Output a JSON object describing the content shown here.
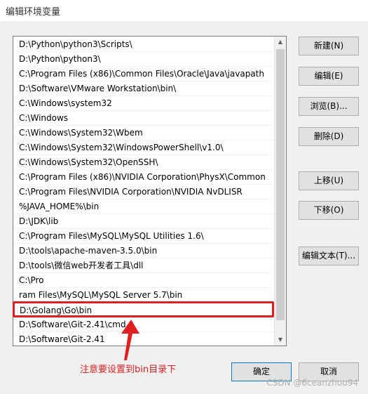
{
  "window": {
    "title": "编辑环境变量"
  },
  "paths": [
    "D:\\Python\\python3\\Scripts\\",
    "D:\\Python\\python3\\",
    "C:\\Program Files (x86)\\Common Files\\Oracle\\Java\\javapath",
    "D:\\Software\\VMware Workstation\\bin\\",
    "C:\\Windows\\system32",
    "C:\\Windows",
    "C:\\Windows\\System32\\Wbem",
    "C:\\Windows\\System32\\WindowsPowerShell\\v1.0\\",
    "C:\\Windows\\System32\\OpenSSH\\",
    "C:\\Program Files (x86)\\NVIDIA Corporation\\PhysX\\Common",
    "C:\\Program Files\\NVIDIA Corporation\\NVIDIA NvDLISR",
    "%JAVA_HOME%\\bin",
    "D:\\JDK\\lib",
    "C:\\Program Files\\MySQL\\MySQL Utilities 1.6\\",
    "D:\\tools\\apache-maven-3.5.0\\bin",
    "D:\\tools\\微信web开发者工具\\dll",
    "C:\\Pro",
    "ram Files\\MySQL\\MySQL Server 5.7\\bin",
    "D:\\Golang\\Go\\bin",
    "D:\\Software\\Git-2.41\\cmd",
    "D:\\Software\\Git-2.41"
  ],
  "selected_index": 18,
  "buttons": {
    "new": "新建(N)",
    "edit": "编辑(E)",
    "browse": "浏览(B)...",
    "delete": "删除(D)",
    "move_up": "上移(U)",
    "move_down": "下移(O)",
    "edit_text": "编辑文本(T)...",
    "ok": "确定",
    "cancel": "取消"
  },
  "annotation": {
    "text": "注意要设置到bin目录下",
    "color": "#e02020"
  },
  "watermark": "CSDN @6ceanzhou94"
}
